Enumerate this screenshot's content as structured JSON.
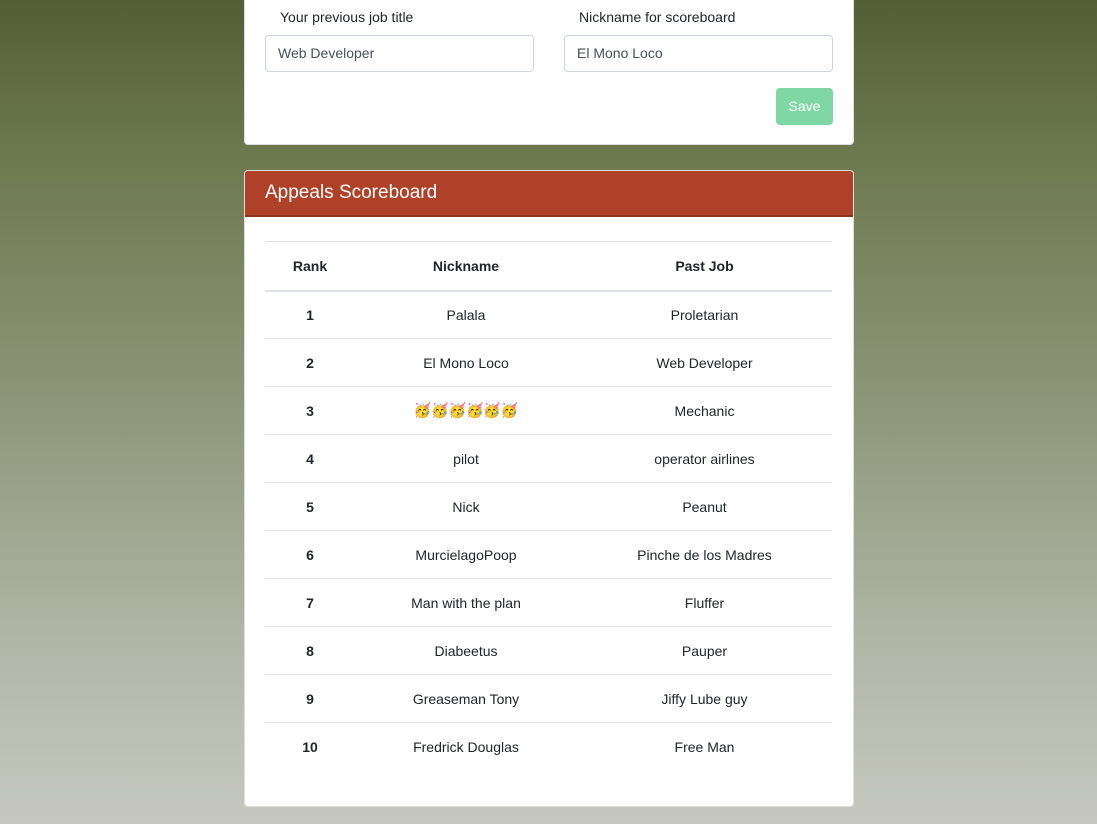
{
  "form": {
    "job_title_label": "Your previous job title",
    "job_title_value": "Web Developer",
    "nickname_label": "Nickname for scoreboard",
    "nickname_value": "El Mono Loco",
    "save_label": "Save"
  },
  "scoreboard": {
    "title": "Appeals Scoreboard",
    "columns": [
      "Rank",
      "Nickname",
      "Past Job"
    ],
    "rows": [
      {
        "rank": "1",
        "nickname": "Palala",
        "past_job": "Proletarian"
      },
      {
        "rank": "2",
        "nickname": "El Mono Loco",
        "past_job": "Web Developer"
      },
      {
        "rank": "3",
        "nickname": "🥳🥳🥳🥳🥳🥳",
        "past_job": "Mechanic"
      },
      {
        "rank": "4",
        "nickname": "pilot",
        "past_job": "operator airlines"
      },
      {
        "rank": "5",
        "nickname": "Nick",
        "past_job": "Peanut"
      },
      {
        "rank": "6",
        "nickname": "MurcielagoPoop",
        "past_job": "Pinche de los Madres"
      },
      {
        "rank": "7",
        "nickname": "Man with the plan",
        "past_job": "Fluffer"
      },
      {
        "rank": "8",
        "nickname": "Diabeetus",
        "past_job": "Pauper"
      },
      {
        "rank": "9",
        "nickname": "Greaseman Tony",
        "past_job": "Jiffy Lube guy"
      },
      {
        "rank": "10",
        "nickname": "Fredrick Douglas",
        "past_job": "Free Man"
      }
    ]
  },
  "colors": {
    "header_bg": "#ae4127",
    "save_button_bg": "#7fd8a3",
    "background_top": "#535e33",
    "background_bottom": "#c6c8bf"
  }
}
